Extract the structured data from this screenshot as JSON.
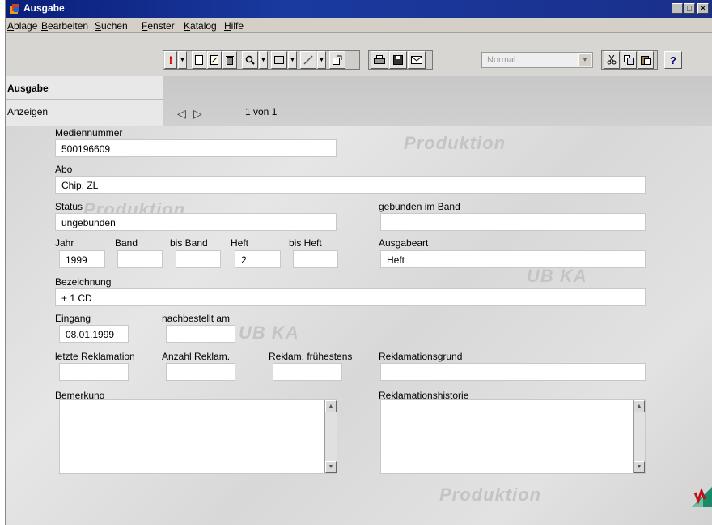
{
  "window": {
    "title": "Ausgabe"
  },
  "menu": [
    "Ablage",
    "Bearbeiten",
    "Suchen",
    "Fenster",
    "Katalog",
    "Hilfe"
  ],
  "toolbar": {
    "zoom_combo": "Normal"
  },
  "sidebar": {
    "header": "Ausgabe",
    "item": "Anzeigen"
  },
  "nav": {
    "pager": "1 von 1"
  },
  "watermarks": [
    "Produktion",
    "Produktion",
    "UB KA",
    "UB KA",
    "Produktion"
  ],
  "form": {
    "mediennummer": {
      "label": "Mediennummer",
      "value": "500196609"
    },
    "abo": {
      "label": "Abo",
      "value": "Chip, ZL"
    },
    "status": {
      "label": "Status",
      "value": "ungebunden"
    },
    "gebunden": {
      "label": "gebunden im Band",
      "value": ""
    },
    "jahr": {
      "label": "Jahr",
      "value": "1999"
    },
    "band": {
      "label": "Band",
      "value": ""
    },
    "bis_band": {
      "label": "bis Band",
      "value": ""
    },
    "heft": {
      "label": "Heft",
      "value": "2"
    },
    "bis_heft": {
      "label": "bis Heft",
      "value": ""
    },
    "ausgabeart": {
      "label": "Ausgabeart",
      "value": "Heft"
    },
    "bezeichnung": {
      "label": "Bezeichnung",
      "value": "+ 1 CD"
    },
    "eingang": {
      "label": "Eingang",
      "value": "08.01.1999"
    },
    "nachbestellt": {
      "label": "nachbestellt am",
      "value": ""
    },
    "letzte_reklamation": {
      "label": "letzte Reklamation",
      "value": ""
    },
    "anzahl_reklam": {
      "label": "Anzahl Reklam.",
      "value": ""
    },
    "reklam_fruehestens": {
      "label": "Reklam. frühestens",
      "value": ""
    },
    "reklamationsgrund": {
      "label": "Reklamationsgrund",
      "value": ""
    },
    "bemerkung": {
      "label": "Bemerkung",
      "value": ""
    },
    "reklamationshistorie": {
      "label": "Reklamationshistorie",
      "value": ""
    }
  }
}
